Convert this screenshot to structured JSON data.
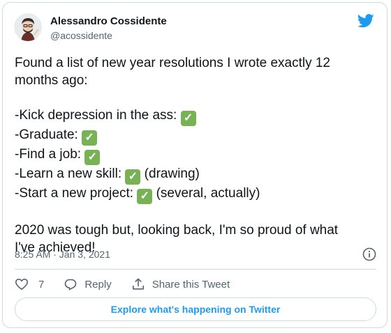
{
  "author": {
    "display_name": "Alessandro Cossidente",
    "handle": "@acossidente"
  },
  "tweet": {
    "lines": [
      "Found a list of new year resolutions I wrote exactly 12",
      "months ago:"
    ],
    "items": [
      {
        "text": "-Kick depression in the ass: ",
        "check": "✓",
        "suffix": ""
      },
      {
        "text": "-Graduate: ",
        "check": "✓",
        "suffix": ""
      },
      {
        "text": "-Find a job: ",
        "check": "✓",
        "suffix": ""
      },
      {
        "text": "-Learn a new skill: ",
        "check": "✓",
        "suffix": " (drawing)"
      },
      {
        "text": "-Start a new project: ",
        "check": "✓",
        "suffix": " (several, actually)"
      }
    ],
    "closing_lines": [
      "2020 was tough but, looking back, I'm so proud of what",
      "I've achieved!"
    ],
    "timestamp": "8:25 AM · Jan 3, 2021"
  },
  "actions": {
    "like_count": "7",
    "reply_label": "Reply",
    "share_label": "Share this Tweet"
  },
  "explore_label": "Explore what's happening on Twitter",
  "colors": {
    "twitter_blue": "#1d9bf0",
    "check_green": "#77b255",
    "muted_text": "#536471",
    "border": "#cfd9de"
  },
  "icons": [
    "twitter-bird-icon",
    "info-icon",
    "heart-icon",
    "reply-icon",
    "share-icon",
    "check-mark-icon"
  ]
}
